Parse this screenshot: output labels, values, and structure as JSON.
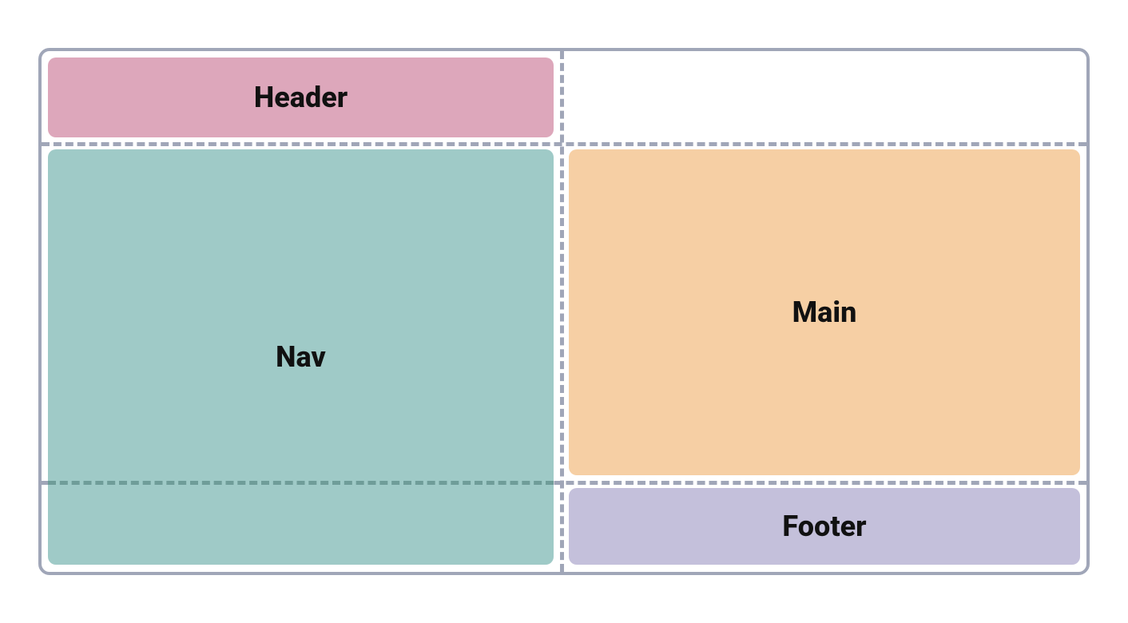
{
  "regions": {
    "header": "Header",
    "nav": "Nav",
    "main": "Main",
    "footer": "Footer"
  },
  "colors": {
    "border": "#a0a6b8",
    "header_bg": "#dda7bb",
    "nav_bg": "#9fcac7",
    "nav_dash": "#6f9d99",
    "main_bg": "#f6cfa4",
    "footer_bg": "#c4c0db",
    "text": "#111111"
  }
}
